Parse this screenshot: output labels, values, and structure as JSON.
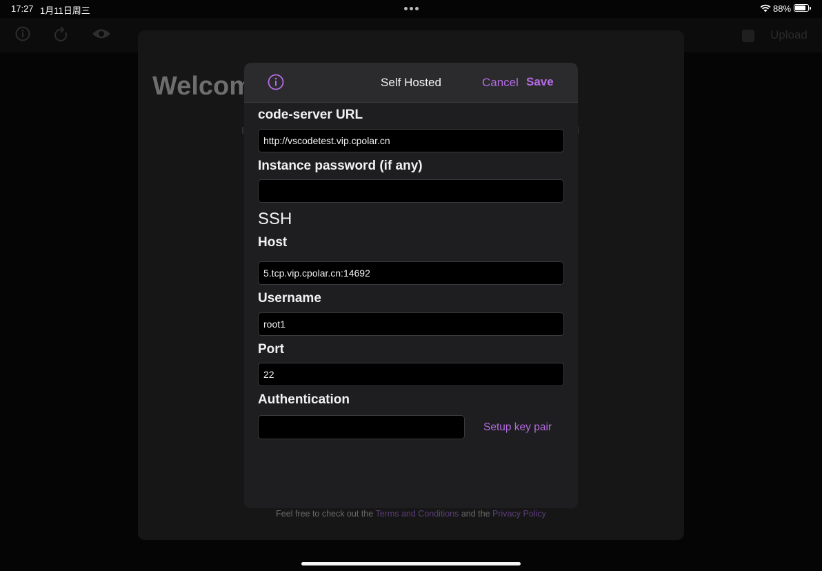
{
  "status_bar": {
    "time": "17:27",
    "date": "1月11日周三",
    "battery": "88%",
    "battery_level": 0.88
  },
  "background": {
    "welcome_text": "Welcom",
    "upload_label": "Upload",
    "footer_prefix": "Feel free to check out the ",
    "footer_terms": "Terms and Conditions",
    "footer_middle": " and the ",
    "footer_privacy": "Privacy Policy"
  },
  "modal": {
    "title": "Self Hosted",
    "cancel_label": "Cancel",
    "save_label": "Save",
    "accent_color": "#b56be6",
    "code_server_url_label": "code-server URL",
    "code_server_url_value": "http://vscodetest.vip.cpolar.cn",
    "password_label": "Instance password (if any)",
    "password_value": "",
    "ssh_section": "SSH",
    "host_label": "Host",
    "host_value": "5.tcp.vip.cpolar.cn:14692",
    "username_label": "Username",
    "username_value": "root1",
    "port_label": "Port",
    "port_value": "22",
    "auth_label": "Authentication",
    "setup_key_pair_label": "Setup key pair"
  },
  "icons": [
    "info-icon",
    "refresh-icon",
    "eye-icon",
    "wifi-icon",
    "battery-icon"
  ]
}
